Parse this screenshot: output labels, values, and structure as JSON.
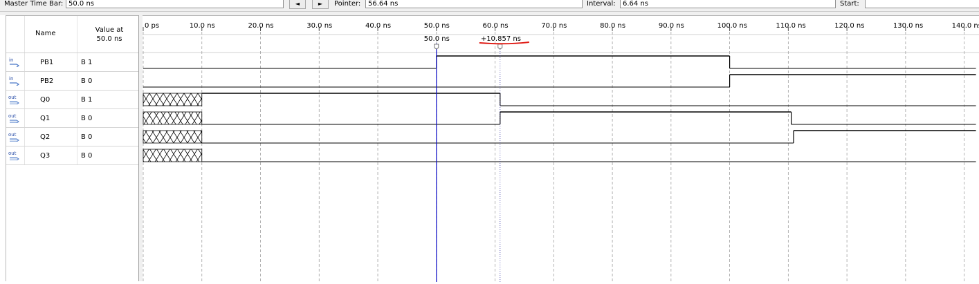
{
  "toolbar": {
    "master_time_bar_label": "Master Time Bar:",
    "master_time_bar_value": "50.0 ns",
    "prev_button": "◄",
    "next_button": "►",
    "pointer_label": "Pointer:",
    "pointer_value": "56.64 ns",
    "interval_label": "Interval:",
    "interval_value": "6.64 ns",
    "start_label": "Start:",
    "start_value": ""
  },
  "signal_table": {
    "name_header": "Name",
    "value_header_line1": "Value at",
    "value_header_line2": "50.0 ns",
    "signals": [
      {
        "type": "in",
        "name": "PB1",
        "value": "B 1"
      },
      {
        "type": "in",
        "name": "PB2",
        "value": "B 0"
      },
      {
        "type": "out",
        "name": "Q0",
        "value": "B 1"
      },
      {
        "type": "out",
        "name": "Q1",
        "value": "B 0"
      },
      {
        "type": "out",
        "name": "Q2",
        "value": "B 0"
      },
      {
        "type": "out",
        "name": "Q3",
        "value": "B 0"
      }
    ]
  },
  "timeline": {
    "ticks": [
      "0 ps",
      "10.0 ns",
      "20.0 ns",
      "30.0 ns",
      "40.0 ns",
      "50.0 ns",
      "60.0 ns",
      "70.0 ns",
      "80.0 ns",
      "90.0 ns",
      "100.0 ns",
      "110.0 ns",
      "120.0 ns",
      "130.0 ns",
      "140.0 ns"
    ],
    "tick_ns": [
      0,
      10,
      20,
      30,
      40,
      50,
      60,
      70,
      80,
      90,
      100,
      110,
      120,
      130,
      140
    ],
    "master_marker_ns": 50.0,
    "master_marker_label": "50.0 ns",
    "secondary_marker_ns": 60.857,
    "secondary_marker_label": "+10.857 ns",
    "annotation_color": "#e0201a",
    "master_line_color": "#1010c8"
  },
  "waveforms": [
    {
      "name": "PB1",
      "segments": [
        {
          "from": 0,
          "to": 50,
          "level": 0
        },
        {
          "from": 50,
          "to": 100,
          "level": 1
        },
        {
          "from": 100,
          "to": 142,
          "level": 0
        }
      ]
    },
    {
      "name": "PB2",
      "segments": [
        {
          "from": 0,
          "to": 100,
          "level": 0
        },
        {
          "from": 100,
          "to": 142,
          "level": 1
        }
      ]
    },
    {
      "name": "Q0",
      "segments": [
        {
          "from": 0,
          "to": 10,
          "level": "X"
        },
        {
          "from": 10,
          "to": 60.857,
          "level": 1
        },
        {
          "from": 60.857,
          "to": 142,
          "level": 0
        }
      ]
    },
    {
      "name": "Q1",
      "segments": [
        {
          "from": 0,
          "to": 10,
          "level": "X"
        },
        {
          "from": 10,
          "to": 60.857,
          "level": 0
        },
        {
          "from": 60.857,
          "to": 110.5,
          "level": 1
        },
        {
          "from": 110.5,
          "to": 142,
          "level": 0
        }
      ]
    },
    {
      "name": "Q2",
      "segments": [
        {
          "from": 0,
          "to": 10,
          "level": "X"
        },
        {
          "from": 10,
          "to": 110.9,
          "level": 0
        },
        {
          "from": 110.9,
          "to": 142,
          "level": 1
        }
      ]
    },
    {
      "name": "Q3",
      "segments": [
        {
          "from": 0,
          "to": 10,
          "level": "X"
        },
        {
          "from": 10,
          "to": 142,
          "level": 0
        }
      ]
    }
  ]
}
